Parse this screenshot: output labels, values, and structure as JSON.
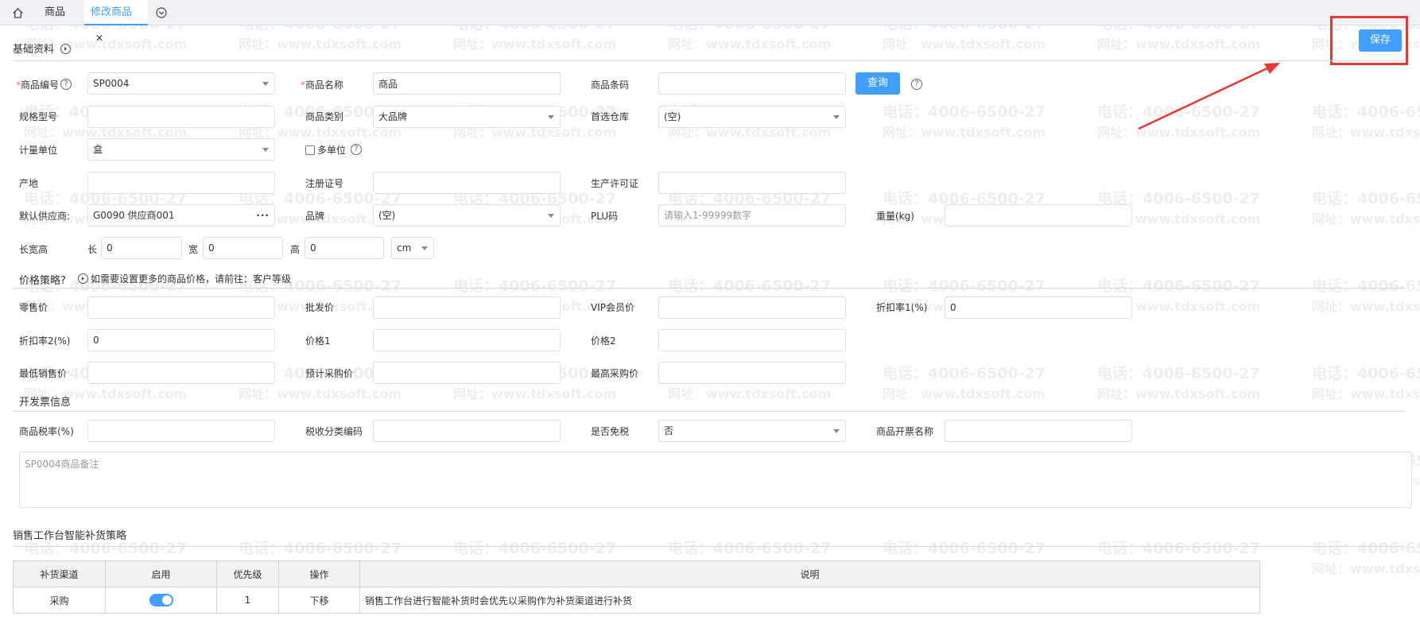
{
  "tabs": {
    "home_icon": "home-icon",
    "items": [
      "商品",
      "修改商品"
    ],
    "close_glyph": "✕",
    "more_icon": "chevron-circle-down-icon"
  },
  "save_button": "保存",
  "sections": {
    "basic": "基础资料",
    "price_strategy": "价格策略?",
    "price_hint": "如需要设置更多的商品价格，请前往：客户等级",
    "invoice": "开发票信息",
    "replenish": "销售工作台智能补货策略"
  },
  "fields": {
    "code_label": "商品编号",
    "code_value": "SP0004",
    "name_label": "商品名称",
    "name_value": "商品",
    "barcode_label": "商品条码",
    "barcode_value": "",
    "query_button": "查询",
    "spec_label": "规格型号",
    "spec_value": "",
    "category_label": "商品类别",
    "category_value": "大品牌",
    "warehouse_label": "首选仓库",
    "warehouse_value": "(空)",
    "unit_label": "计量单位",
    "unit_value": "盒",
    "multi_unit_label": "多单位",
    "origin_label": "产地",
    "origin_value": "",
    "reg_label": "注册证号",
    "reg_value": "",
    "license_label": "生产许可证",
    "license_value": "",
    "supplier_label": "默认供应商:",
    "supplier_value": "G0090  供应商001",
    "supplier_dots": "···",
    "brand_label": "品牌",
    "brand_value": "(空)",
    "plu_label": "PLU码",
    "plu_placeholder": "请输入1-99999数字",
    "weight_label": "重量(kg)",
    "weight_value": "",
    "dims_label": "长宽高",
    "len_label": "长",
    "len_value": "0",
    "wid_label": "宽",
    "wid_value": "0",
    "hei_label": "高",
    "hei_value": "0",
    "dims_unit": "cm"
  },
  "prices": {
    "retail_label": "零售价",
    "retail_value": "",
    "wholesale_label": "批发价",
    "wholesale_value": "",
    "vip_label": "VIP会员价",
    "vip_value": "",
    "discount1_label": "折扣率1(%)",
    "discount1_value": "0",
    "discount2_label": "折扣率2(%)",
    "discount2_value": "0",
    "price1_label": "价格1",
    "price1_value": "",
    "price2_label": "价格2",
    "price2_value": "",
    "min_sale_label": "最低销售价",
    "min_sale_value": "",
    "est_purchase_label": "预计采购价",
    "est_purchase_value": "",
    "max_purchase_label": "最高采购价",
    "max_purchase_value": ""
  },
  "invoice": {
    "tax_rate_label": "商品税率(%)",
    "tax_rate_value": "",
    "tax_code_label": "税收分类编码",
    "tax_code_value": "",
    "tax_free_label": "是否免税",
    "tax_free_value": "否",
    "invoice_name_label": "商品开票名称",
    "invoice_name_value": ""
  },
  "remark": "SP0004商品备注",
  "grid": {
    "headers": [
      "补货渠道",
      "启用",
      "优先级",
      "操作",
      "说明"
    ],
    "rows": [
      {
        "channel": "采购",
        "enabled": true,
        "priority": "1",
        "action": "下移",
        "desc": "销售工作台进行智能补货时会优先以采购作为补货渠道进行补货"
      }
    ]
  },
  "watermark": {
    "phone": "电话：4006-6500-27",
    "site": "网址：www.tdxsoft.com"
  },
  "colors": {
    "primary": "#409eff",
    "highlight": "#e53935"
  }
}
